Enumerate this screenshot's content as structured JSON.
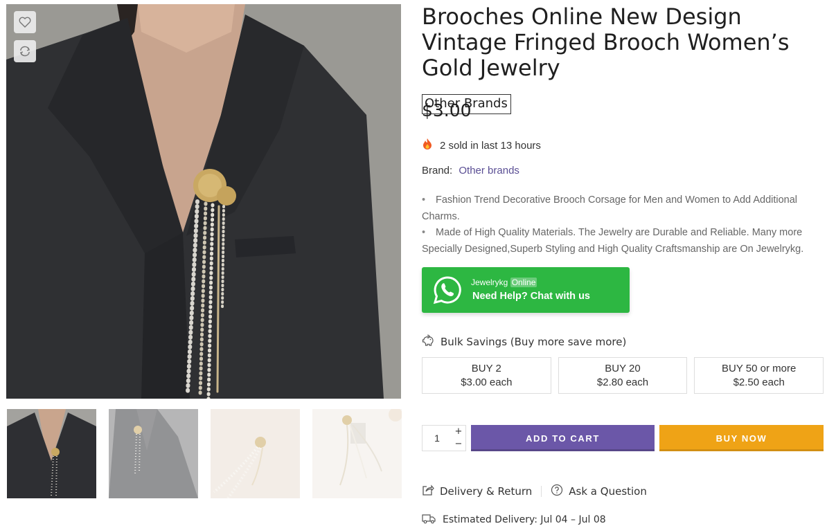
{
  "product": {
    "title": "Brooches Online New Design Vintage Fringed Brooch Women’s Gold Jewelry",
    "brand_badge": "Other Brands",
    "price": "$3.00",
    "sold_text": "2 sold in last 13 hours",
    "brand_label": "Brand:",
    "brand_link": "Other brands",
    "description": [
      "Fashion Trend Decorative Brooch Corsage for Men and Women to Add Additional Charms.",
      "Made of High Quality Materials. The Jewelry are Durable and Reliable. Many more Specially Designed,Superb Styling and High Quality Craftsmanship are On Jewelrykg."
    ],
    "bullet": "•"
  },
  "whatsapp": {
    "name": "Jewelrykg",
    "status": "Online",
    "help_text": "Need Help? Chat with us",
    "color": "#2db742"
  },
  "bulk": {
    "title": "Bulk Savings (Buy more save more)",
    "tiers": [
      {
        "label": "BUY 2",
        "price": "$3.00 each"
      },
      {
        "label": "BUY 20",
        "price": "$2.80 each"
      },
      {
        "label": "BUY 50 or more",
        "price": "$2.50 each"
      }
    ]
  },
  "cart": {
    "quantity": "1",
    "plus": "+",
    "minus": "−",
    "add_to_cart": "ADD TO CART",
    "buy_now": "BUY NOW",
    "add_color": "#6b57a8",
    "buy_color": "#efa316"
  },
  "links": {
    "delivery_return": "Delivery & Return",
    "ask_question": "Ask a Question",
    "estimated_delivery": "Estimated Delivery: Jul 04 – Jul 08"
  },
  "gallery": {
    "icons": [
      "heart-icon",
      "compare-icon"
    ],
    "thumb_count": 4,
    "active_thumb": 1
  }
}
